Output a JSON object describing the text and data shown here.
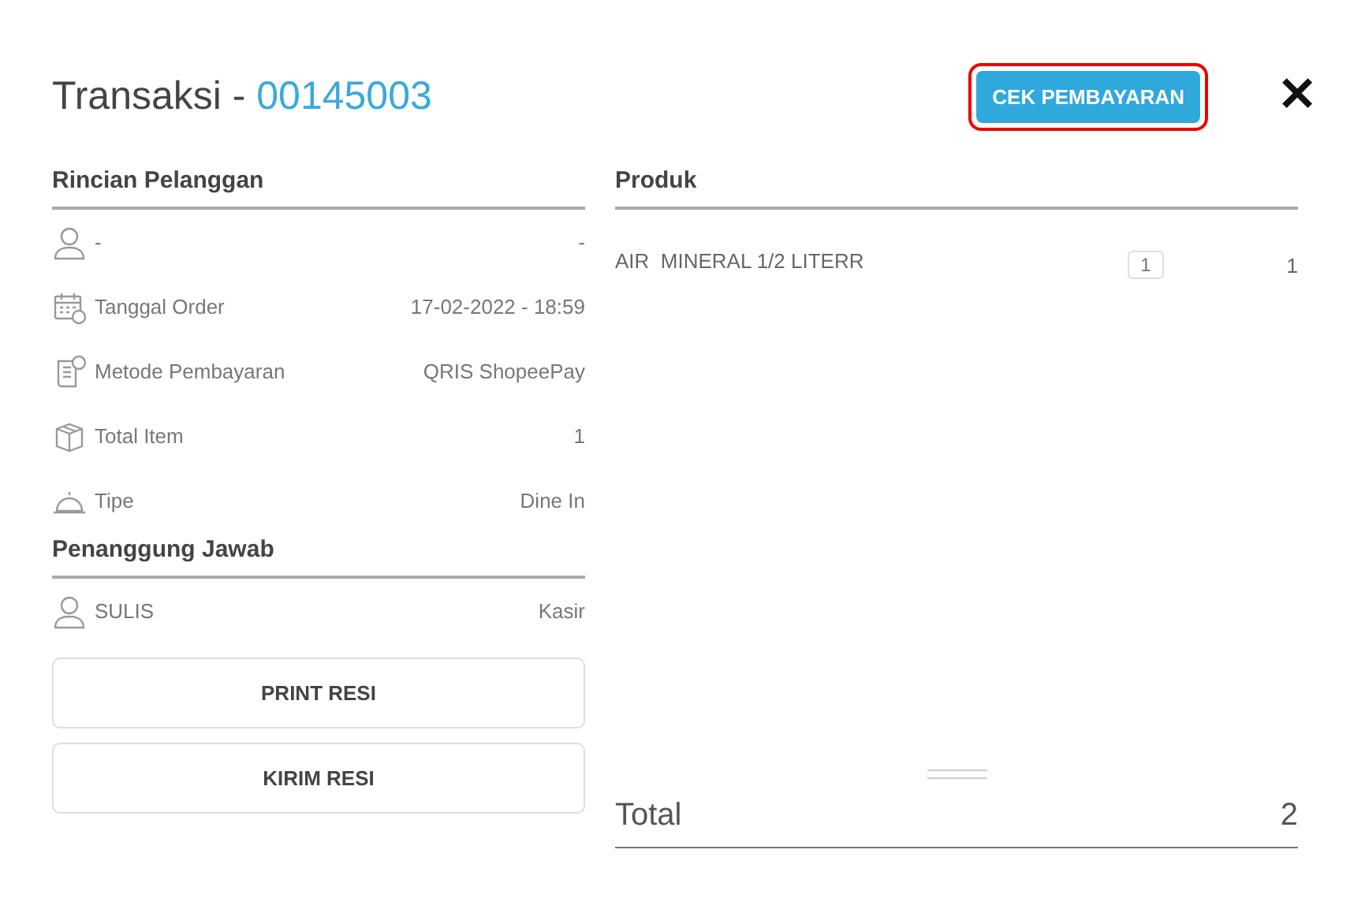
{
  "header": {
    "title": "Transaksi - ",
    "transaction_id": "00145003",
    "check_button": {
      "label": "CEK PEMBAYARAN",
      "highlighted": true
    },
    "close": "✕"
  },
  "customer": {
    "heading": "Rincian Pelanggan",
    "rows": [
      {
        "kind": "person",
        "label": "-",
        "value": "-"
      },
      {
        "kind": "calendar",
        "label": "Tanggal Order",
        "value": "17-02-2022 - 18:59"
      },
      {
        "kind": "receipt",
        "label": "Metode Pembayaran",
        "value": "QRIS ShopeePay"
      },
      {
        "kind": "box",
        "label": "Total Item",
        "value": "1"
      },
      {
        "kind": "bell",
        "label": "Tipe",
        "value": "Dine In"
      }
    ]
  },
  "responsible": {
    "heading": "Penanggung Jawab",
    "rows": [
      {
        "kind": "person",
        "label": "SULIS",
        "value": "Kasir"
      }
    ]
  },
  "buttons": [
    "PRINT RESI",
    "KIRIM RESI"
  ],
  "products": {
    "heading": "Produk",
    "rows": [
      {
        "name": "AIR  MINERAL 1/2 LITERR",
        "qty": "1",
        "amount": "1"
      }
    ]
  },
  "total": {
    "label": "Total",
    "value": "2"
  }
}
